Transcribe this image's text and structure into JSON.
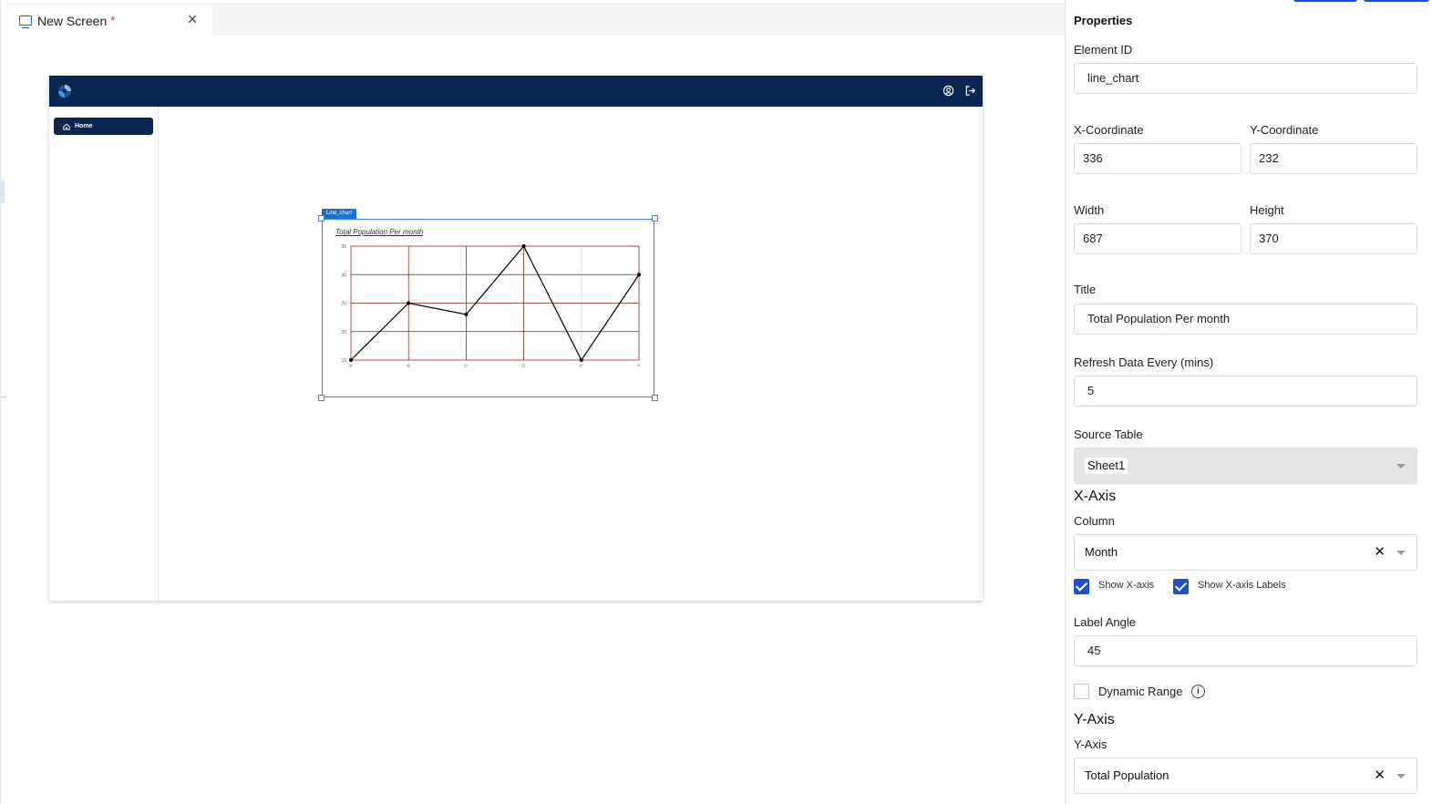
{
  "tab": {
    "title": "New Screen",
    "dirty_marker": "*"
  },
  "app": {
    "nav_home": "Home",
    "colors": {
      "appbar": "#0b2553",
      "accent": "#1d4ed8"
    }
  },
  "widget": {
    "tag": "Line_chart"
  },
  "chart_data": {
    "type": "line",
    "title": "Total Population Per month",
    "categories": [
      "A",
      "B",
      "C",
      "D",
      "E",
      "F"
    ],
    "series": [
      {
        "values": [
          15,
          25,
          23,
          35,
          15,
          30
        ]
      }
    ],
    "y_ticks": [
      "15",
      "20",
      "25",
      "30",
      "35"
    ],
    "ylim": [
      15,
      35
    ],
    "grid": true,
    "colors": {
      "line": "#000000",
      "grid": "#8b1a1a",
      "grid_minor": "#d8d8d8"
    }
  },
  "properties": {
    "heading": "Properties",
    "element_id_label": "Element ID",
    "element_id": "line_chart",
    "x_label": "X-Coordinate",
    "x_value": "336",
    "y_label": "Y-Coordinate",
    "y_value": "232",
    "width_label": "Width",
    "width_value": "687",
    "height_label": "Height",
    "height_value": "370",
    "title_label": "Title",
    "title_value": "Total Population Per month",
    "refresh_label": "Refresh Data Every (mins)",
    "refresh_value": "5",
    "source_label": "Source Table",
    "source_value": "Sheet1",
    "xaxis_heading": "X-Axis",
    "column_label": "Column",
    "column_value": "Month",
    "show_xaxis": "Show X-axis",
    "show_xaxis_labels": "Show X-axis Labels",
    "label_angle_label": "Label Angle",
    "label_angle_value": "45",
    "dynamic_range": "Dynamic Range",
    "yaxis_heading": "Y-Axis",
    "yaxis_label": "Y-Axis",
    "yaxis_value": "Total Population",
    "clear_symbol": "✕",
    "info_symbol": "i"
  }
}
